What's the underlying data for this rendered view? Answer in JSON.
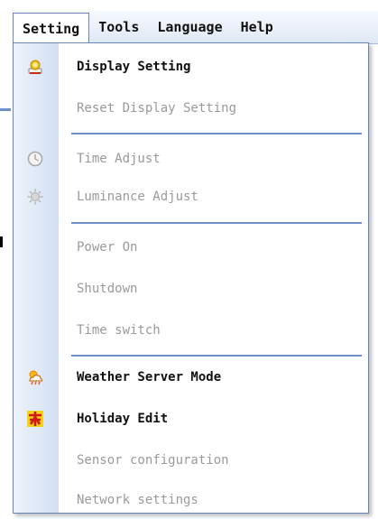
{
  "menubar": {
    "items": [
      "Setting",
      "Tools",
      "Language",
      "Help"
    ]
  },
  "menu": {
    "items": [
      {
        "label": "Display Setting",
        "enabled": true
      },
      {
        "label": "Reset Display Setting",
        "enabled": false
      },
      {
        "label": "Time Adjust",
        "enabled": false
      },
      {
        "label": "Luminance Adjust",
        "enabled": false
      },
      {
        "label": "Power On",
        "enabled": false
      },
      {
        "label": "Shutdown",
        "enabled": false
      },
      {
        "label": "Time switch",
        "enabled": false
      },
      {
        "label": "Weather Server Mode",
        "enabled": true
      },
      {
        "label": "Holiday Edit",
        "enabled": true
      },
      {
        "label": "Sensor configuration",
        "enabled": false
      },
      {
        "label": "Network settings",
        "enabled": false
      }
    ]
  },
  "colors": {
    "accent_border": "#6a86b8",
    "separator": "#6f8fc7",
    "disabled_text": "#9a9a9a"
  }
}
